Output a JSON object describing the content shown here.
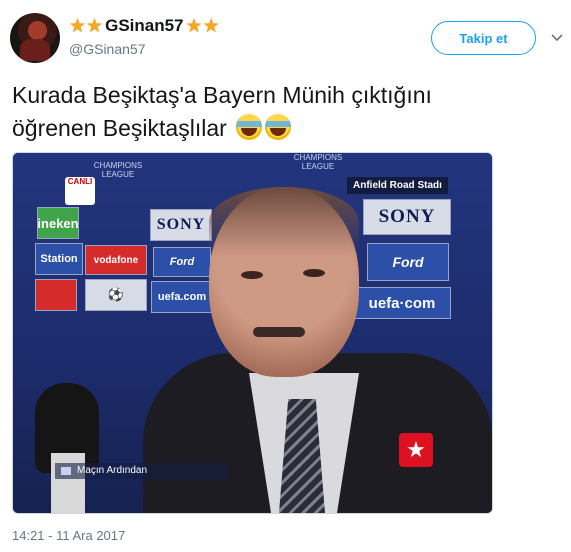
{
  "tweet": {
    "display_name": "GSinan57",
    "handle": "@GSinan57",
    "follow_label": "Takip et",
    "text_line1": "Kurada Beşiktaş'a Bayern Münih çıktığını",
    "text_line2": "öğrenen Beşiktaşlılar",
    "timestamp": "14:21 - 11 Ara 2017"
  },
  "media": {
    "location_label": "Anfield Road Stadı",
    "caption": "Maçın Ardından",
    "badge": "CANLI",
    "sponsors": [
      "ineken",
      "SONY",
      "Station",
      "vodafone",
      "Ford",
      "uefa.com",
      "SONY",
      "Ford",
      "uefa·com"
    ],
    "league_text": "CHAMPIONS LEAGUE",
    "channel_logo_text": "★"
  },
  "colors": {
    "accent": "#1da1f2",
    "text": "#14171a",
    "secondary_text": "#657786",
    "star": "#f5a623"
  },
  "icons": [
    "star-icon",
    "chevron-down-icon",
    "face-with-tears-of-joy-emoji"
  ]
}
